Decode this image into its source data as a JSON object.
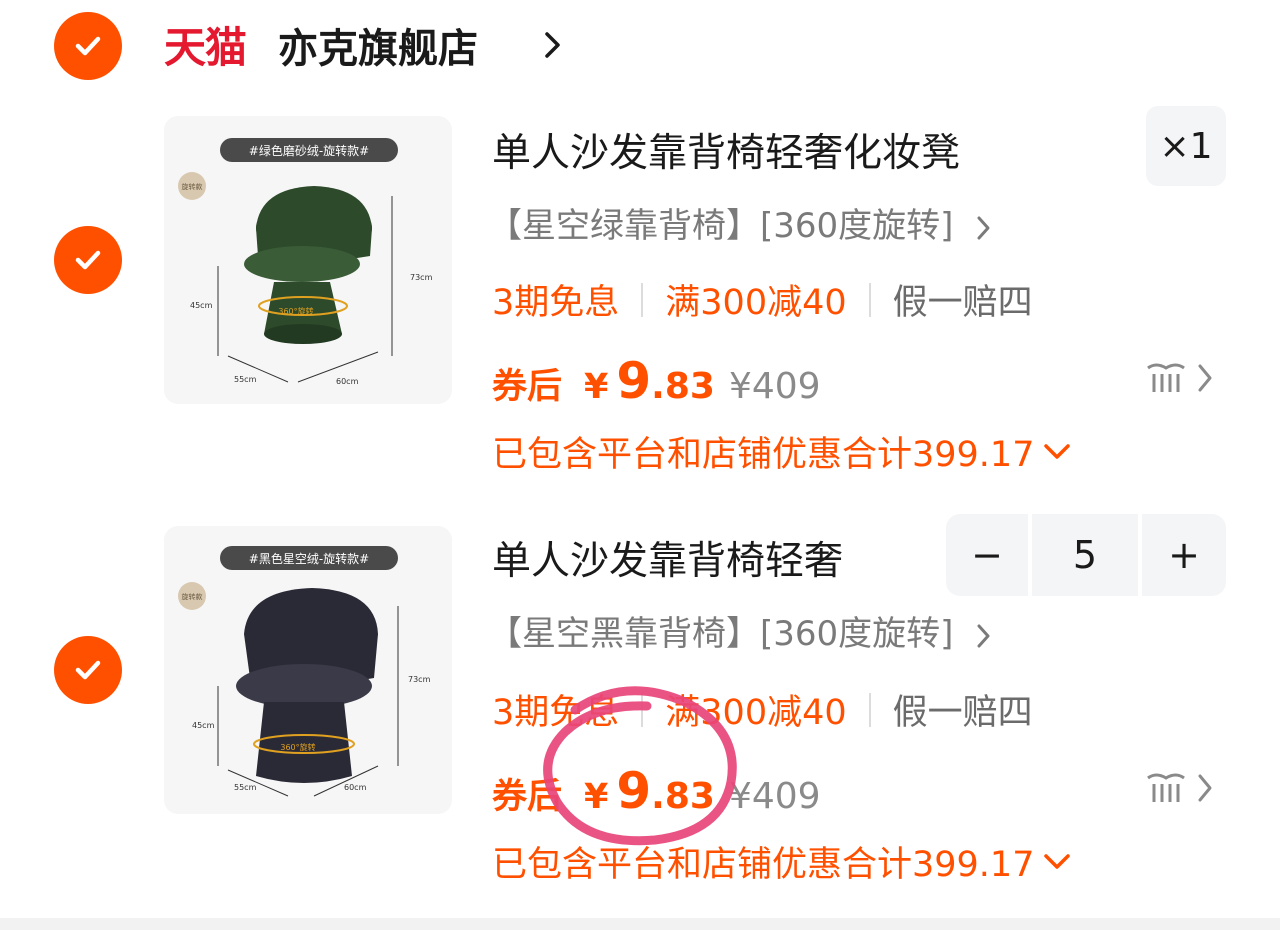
{
  "shop": {
    "platform": "天猫",
    "name": "亦克旗舰店"
  },
  "items": [
    {
      "title": "单人沙发靠背椅轻奢化妆凳",
      "image_tag": "#绿色磨砂绒-旋转款#",
      "image_badge": "旋转款",
      "image_dims": [
        "73cm",
        "45cm",
        "55cm",
        "60cm"
      ],
      "image_rotate": "360°旋转",
      "sku": "【星空绿靠背椅】[360度旋转]",
      "promo_installment": "3期免息",
      "promo_discount": "满300减40",
      "promo_guarantee": "假一赔四",
      "coupon_label": "券后",
      "currency": "¥",
      "price_int": "9",
      "price_dec": ".83",
      "original_price": "¥409",
      "discount_note": "已包含平台和店铺优惠合计399.17",
      "quantity_badge": "×1",
      "chair_color": "#2d4a2b"
    },
    {
      "title": "单人沙发靠背椅轻奢",
      "image_tag": "#黑色星空绒-旋转款#",
      "image_badge": "旋转款",
      "image_dims": [
        "73cm",
        "45cm",
        "55cm",
        "60cm"
      ],
      "image_rotate": "360°旋转",
      "sku": "【星空黑靠背椅】[360度旋转]",
      "promo_installment": "3期免息",
      "promo_discount": "满300减40",
      "promo_guarantee": "假一赔四",
      "coupon_label": "券后",
      "currency": "¥",
      "price_int": "9",
      "price_dec": ".83",
      "original_price": "¥409",
      "discount_note": "已包含平台和店铺优惠合计399.17",
      "stepper": {
        "minus": "−",
        "value": "5",
        "plus": "+"
      },
      "chair_color": "#2a2a36"
    }
  ],
  "colors": {
    "accent": "#ff5000",
    "tmall_red": "#e4182f",
    "annotation": "#e8457a"
  },
  "icons": [
    "check-icon",
    "chevron-right-icon",
    "chevron-down-icon",
    "similar-items-icon"
  ]
}
